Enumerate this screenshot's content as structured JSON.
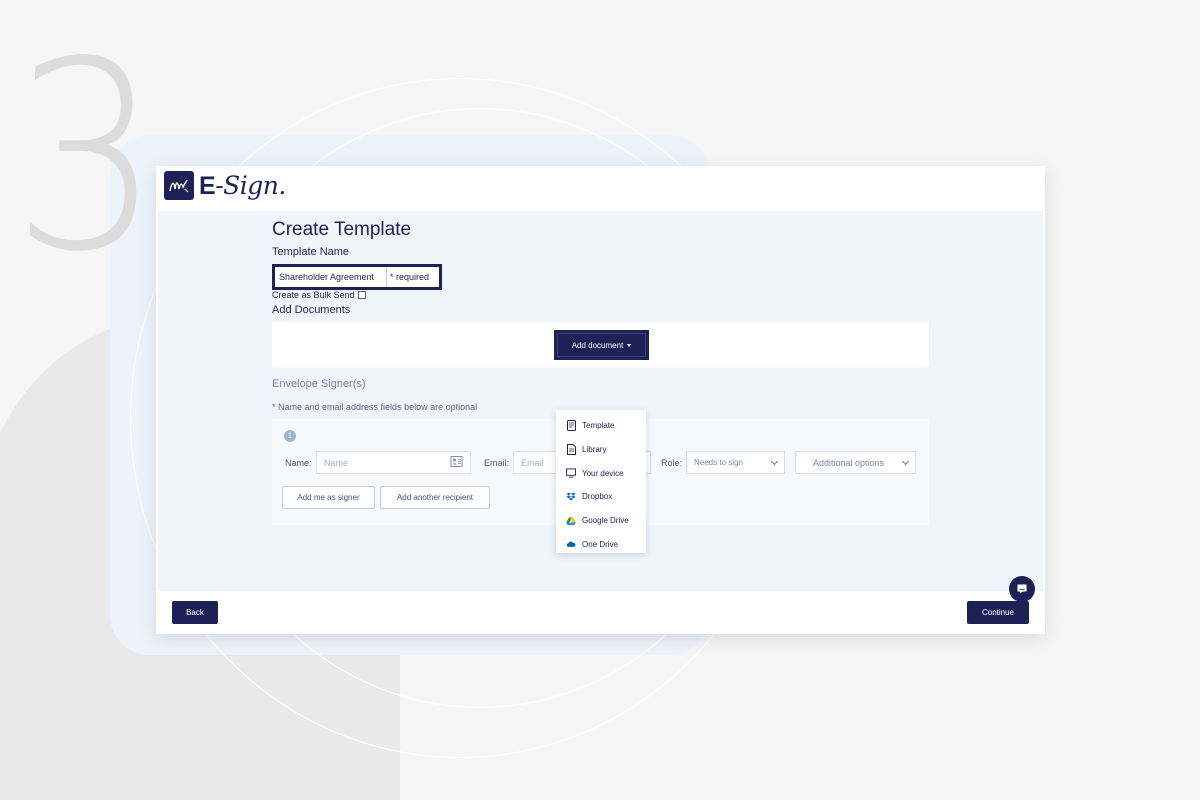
{
  "backdrop": {
    "step_number": "3"
  },
  "app": {
    "logo_text_e": "E",
    "logo_text_sign": "-Sign."
  },
  "page": {
    "title": "Create Template"
  },
  "template_name": {
    "label": "Template Name",
    "value": "Shareholder Agreement",
    "required_note": "* required"
  },
  "bulk_send": {
    "label": "Create as Bulk Send",
    "checked": false
  },
  "documents": {
    "label": "Add Documents",
    "add_button_label": "Add document",
    "menu": [
      {
        "label": "Template",
        "icon": "template-icon"
      },
      {
        "label": "Library",
        "icon": "library-icon"
      },
      {
        "label": "Your device",
        "icon": "device-icon"
      },
      {
        "label": "Dropbox",
        "icon": "dropbox-icon"
      },
      {
        "label": "Google Drive",
        "icon": "google-drive-icon"
      },
      {
        "label": "One Drive",
        "icon": "onedrive-icon"
      }
    ]
  },
  "signers": {
    "title": "Envelope Signer(s)",
    "note": "* Name and email address fields below are optional",
    "items": [
      {
        "number": "1",
        "name_label": "Name:",
        "name_placeholder": "Name",
        "email_label": "Email:",
        "email_placeholder": "Email",
        "role_label": "Role:",
        "role_value": "Needs to sign",
        "additional_options": "Additional options"
      }
    ],
    "add_me_button": "Add me as signer",
    "add_another_button": "Add another recipient"
  },
  "footer": {
    "back_label": "Back",
    "continue_label": "Continue"
  },
  "colors": {
    "brand_navy": "#1c2256",
    "panel_bg": "#f0f5fc",
    "page_bg": "#f6f6f6"
  }
}
